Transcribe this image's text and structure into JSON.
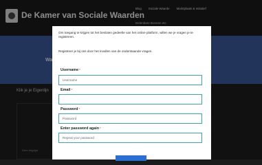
{
  "site": {
    "title": "De Kamer van Sociale Waarden",
    "nav": [
      "Blog",
      "Sociale Waarde",
      "Marktplaats & Initiatief"
    ],
    "tagline": "Delenbare Bonnen etc",
    "banner_text": "Wa",
    "content_title": "Klik je je Eigenlijn",
    "content_text": "Dere begrijpt"
  },
  "modal": {
    "intro": "Om toegang te krijgen tot het besloten gedeelte van het online platform, willen we je vragen je te registreren.",
    "instruction": "Registreer je bij ons door het invullen van de onderstaande vragen.",
    "required_mark": "*",
    "fields": [
      {
        "label": "Username",
        "placeholder": "Username"
      },
      {
        "label": "Email",
        "placeholder": ""
      },
      {
        "label": "Password",
        "placeholder": "Password"
      },
      {
        "label": "Enter password again",
        "placeholder": "Repeat your password"
      }
    ]
  },
  "colors": {
    "accent_border": "#3aa6a6",
    "submit_button": "#2a6fd6",
    "banner": "#3e5fa3"
  }
}
